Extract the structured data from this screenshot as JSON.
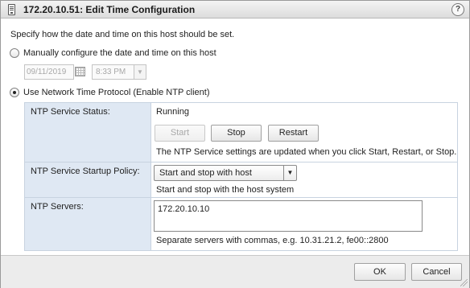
{
  "dialog": {
    "title": "172.20.10.51: Edit Time Configuration",
    "help_label": "?"
  },
  "intro_text": "Specify how the date and time on this host should be set.",
  "manual": {
    "label": "Manually configure the date and time on this host",
    "selected": false,
    "date_value": "09/11/2019",
    "time_value": "8:33 PM",
    "enabled": false
  },
  "ntp": {
    "label": "Use Network Time Protocol (Enable NTP client)",
    "selected": true,
    "service_status": {
      "label": "NTP Service Status:",
      "value": "Running",
      "start_label": "Start",
      "stop_label": "Stop",
      "restart_label": "Restart",
      "note": "The NTP Service settings are updated when you click Start, Restart, or Stop."
    },
    "startup_policy": {
      "label": "NTP Service Startup Policy:",
      "selected_option": "Start and stop with host",
      "description": "Start and stop with the host system"
    },
    "servers": {
      "label": "NTP Servers:",
      "value": "172.20.10.10",
      "hint": "Separate servers with commas, e.g. 10.31.21.2, fe00::2800"
    }
  },
  "footer": {
    "ok_label": "OK",
    "cancel_label": "Cancel"
  },
  "icons": [
    "host-icon",
    "help-icon",
    "calendar-icon",
    "dropdown-arrow-icon",
    "resize-grip-icon"
  ]
}
